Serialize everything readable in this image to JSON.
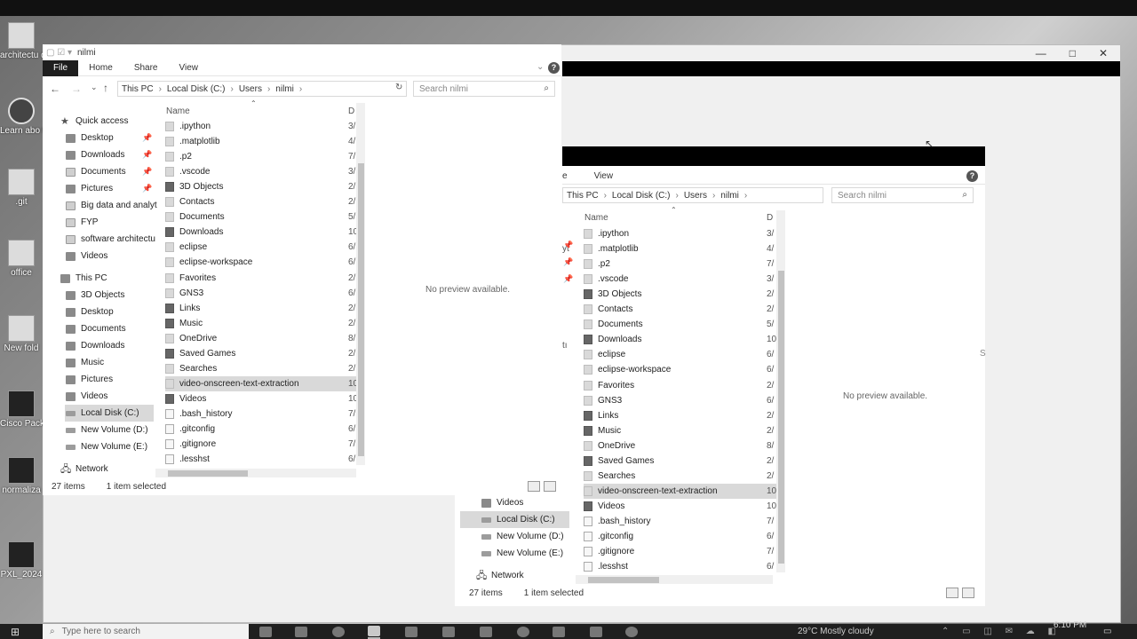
{
  "desktop": {
    "icons": [
      {
        "label": "architectu diagram",
        "kind": "file"
      },
      {
        "label": "Learn abo this pictu",
        "kind": "round"
      },
      {
        "label": ".git",
        "kind": "file"
      },
      {
        "label": "office",
        "kind": "file"
      },
      {
        "label": "New fold",
        "kind": "file"
      },
      {
        "label": "Cisco Pack Tracer",
        "kind": "dark"
      },
      {
        "label": "normaliza",
        "kind": "dark"
      },
      {
        "label": "PXL_2024",
        "kind": "dark"
      }
    ]
  },
  "window_controls": {
    "minimize": "—",
    "maximize": "□",
    "close": "✕"
  },
  "explorer_front": {
    "title": "nilmi",
    "ribbon_tabs": [
      "File",
      "Home",
      "Share",
      "View"
    ],
    "help": "?",
    "breadcrumb": [
      "This PC",
      "Local Disk (C:)",
      "Users",
      "nilmi"
    ],
    "search_placeholder": "Search nilmi",
    "column_name": "Name",
    "column_date": "D",
    "nav": {
      "quick_access": "Quick access",
      "quick_items": [
        "Desktop",
        "Downloads",
        "Documents",
        "Pictures",
        "Big data and analyt",
        "FYP",
        "software architectu",
        "Videos"
      ],
      "this_pc": "This PC",
      "pc_items": [
        "3D Objects",
        "Desktop",
        "Documents",
        "Downloads",
        "Music",
        "Pictures",
        "Videos",
        "Local Disk (C:)",
        "New Volume (D:)",
        "New Volume (E:)"
      ],
      "network": "Network"
    },
    "files": [
      {
        "name": ".ipython",
        "date": "3/",
        "kind": "folder"
      },
      {
        "name": ".matplotlib",
        "date": "4/",
        "kind": "folder"
      },
      {
        "name": ".p2",
        "date": "7/",
        "kind": "folder"
      },
      {
        "name": ".vscode",
        "date": "3/",
        "kind": "folder"
      },
      {
        "name": "3D Objects",
        "date": "2/",
        "kind": "special"
      },
      {
        "name": "Contacts",
        "date": "2/",
        "kind": "folder"
      },
      {
        "name": "Documents",
        "date": "5/",
        "kind": "folder"
      },
      {
        "name": "Downloads",
        "date": "10",
        "kind": "special"
      },
      {
        "name": "eclipse",
        "date": "6/",
        "kind": "folder"
      },
      {
        "name": "eclipse-workspace",
        "date": "6/",
        "kind": "folder"
      },
      {
        "name": "Favorites",
        "date": "2/",
        "kind": "folder"
      },
      {
        "name": "GNS3",
        "date": "6/",
        "kind": "folder"
      },
      {
        "name": "Links",
        "date": "2/",
        "kind": "special"
      },
      {
        "name": "Music",
        "date": "2/",
        "kind": "special"
      },
      {
        "name": "OneDrive",
        "date": "8/",
        "kind": "folder"
      },
      {
        "name": "Saved Games",
        "date": "2/",
        "kind": "special"
      },
      {
        "name": "Searches",
        "date": "2/",
        "kind": "folder"
      },
      {
        "name": "video-onscreen-text-extraction",
        "date": "10",
        "kind": "folder"
      },
      {
        "name": "Videos",
        "date": "10",
        "kind": "special"
      },
      {
        "name": ".bash_history",
        "date": "7/",
        "kind": "file"
      },
      {
        "name": ".gitconfig",
        "date": "6/",
        "kind": "file"
      },
      {
        "name": ".gitignore",
        "date": "7/",
        "kind": "file"
      },
      {
        "name": ".lesshst",
        "date": "6/",
        "kind": "file"
      }
    ],
    "preview": "No preview available.",
    "status_count": "27 items",
    "status_selected": "1 item selected"
  },
  "explorer_back": {
    "ribbon_tabs": [
      "e",
      "View"
    ],
    "help": "?",
    "breadcrumb": [
      "This PC",
      "Local Disk (C:)",
      "Users",
      "nilmi"
    ],
    "search_placeholder": "Search nilmi",
    "column_name": "Name",
    "column_date": "D",
    "nav_items": [
      "Videos",
      "Local Disk (C:)",
      "New Volume (D:)",
      "New Volume (E:)"
    ],
    "network": "Network",
    "side_fragments": [
      "yt",
      "tı"
    ],
    "right_fragment": "S",
    "files": [
      {
        "name": ".ipython",
        "date": "3/",
        "kind": "folder"
      },
      {
        "name": ".matplotlib",
        "date": "4/",
        "kind": "folder"
      },
      {
        "name": ".p2",
        "date": "7/",
        "kind": "folder"
      },
      {
        "name": ".vscode",
        "date": "3/",
        "kind": "folder"
      },
      {
        "name": "3D Objects",
        "date": "2/",
        "kind": "special"
      },
      {
        "name": "Contacts",
        "date": "2/",
        "kind": "folder"
      },
      {
        "name": "Documents",
        "date": "5/",
        "kind": "folder"
      },
      {
        "name": "Downloads",
        "date": "10",
        "kind": "special"
      },
      {
        "name": "eclipse",
        "date": "6/",
        "kind": "folder"
      },
      {
        "name": "eclipse-workspace",
        "date": "6/",
        "kind": "folder"
      },
      {
        "name": "Favorites",
        "date": "2/",
        "kind": "folder"
      },
      {
        "name": "GNS3",
        "date": "6/",
        "kind": "folder"
      },
      {
        "name": "Links",
        "date": "2/",
        "kind": "special"
      },
      {
        "name": "Music",
        "date": "2/",
        "kind": "special"
      },
      {
        "name": "OneDrive",
        "date": "8/",
        "kind": "folder"
      },
      {
        "name": "Saved Games",
        "date": "2/",
        "kind": "special"
      },
      {
        "name": "Searches",
        "date": "2/",
        "kind": "folder"
      },
      {
        "name": "video-onscreen-text-extraction",
        "date": "10",
        "kind": "folder"
      },
      {
        "name": "Videos",
        "date": "10",
        "kind": "special"
      },
      {
        "name": ".bash_history",
        "date": "7/",
        "kind": "file"
      },
      {
        "name": ".gitconfig",
        "date": "6/",
        "kind": "file"
      },
      {
        "name": ".gitignore",
        "date": "7/",
        "kind": "file"
      },
      {
        "name": ".lesshst",
        "date": "6/",
        "kind": "file"
      }
    ],
    "preview": "No preview available.",
    "status_count": "27 items",
    "status_selected": "1 item selected"
  },
  "taskbar": {
    "search_placeholder": "Type here to search",
    "weather": "29°C  Mostly cloudy",
    "time": "6:10 PM"
  }
}
